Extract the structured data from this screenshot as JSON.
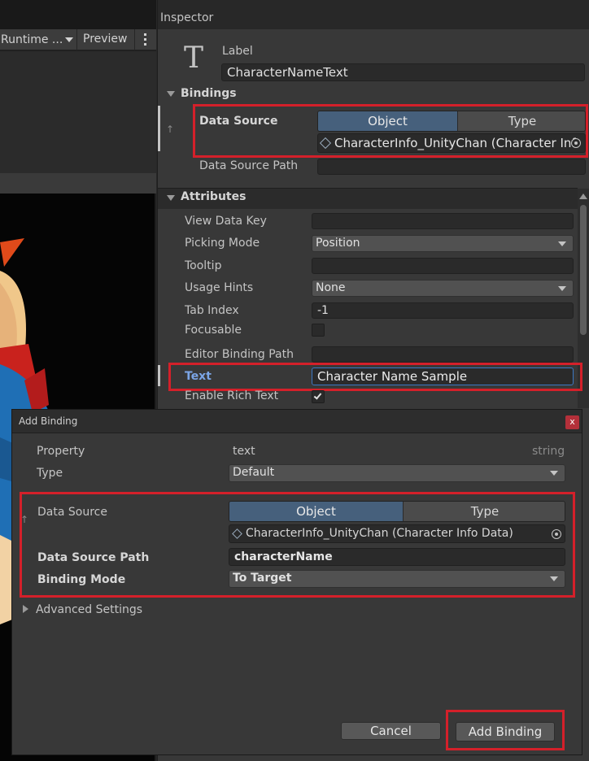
{
  "left": {
    "runtime_dropdown": "Runtime ...",
    "preview_label": "Preview"
  },
  "inspector": {
    "title": "Inspector",
    "type_label": "Label",
    "element_name": "CharacterNameText",
    "bindings_header": "Bindings",
    "data_source_label": "Data Source",
    "toggle_object": "Object",
    "toggle_type": "Type",
    "data_source_value": "CharacterInfo_UnityChan (Character Inf",
    "data_source_path_label": "Data Source Path",
    "attributes_header": "Attributes",
    "rows": {
      "view_data_key": "View Data Key",
      "picking_mode": "Picking Mode",
      "picking_mode_value": "Position",
      "tooltip": "Tooltip",
      "usage_hints": "Usage Hints",
      "usage_hints_value": "None",
      "tab_index": "Tab Index",
      "tab_index_value": "-1",
      "focusable": "Focusable",
      "editor_binding_path": "Editor Binding Path",
      "text": "Text",
      "text_value": "Character Name Sample",
      "enable_rich_text": "Enable Rich Text"
    }
  },
  "dialog": {
    "title": "Add Binding",
    "close": "x",
    "property_label": "Property",
    "property_value": "text",
    "property_type": "string",
    "type_label": "Type",
    "type_value": "Default",
    "data_source_label": "Data Source",
    "toggle_object": "Object",
    "toggle_type": "Type",
    "data_source_value": "CharacterInfo_UnityChan (Character Info Data)",
    "data_source_path_label": "Data Source Path",
    "data_source_path_value": "characterName",
    "binding_mode_label": "Binding Mode",
    "binding_mode_value": "To Target",
    "advanced_settings": "Advanced Settings",
    "cancel": "Cancel",
    "add_binding": "Add Binding"
  },
  "colors": {
    "highlight_red": "#d4202a",
    "accent_blue": "#46607c",
    "text_link_blue": "#7ba5e6",
    "panel_bg": "#383838",
    "dark_bg": "#282828"
  }
}
